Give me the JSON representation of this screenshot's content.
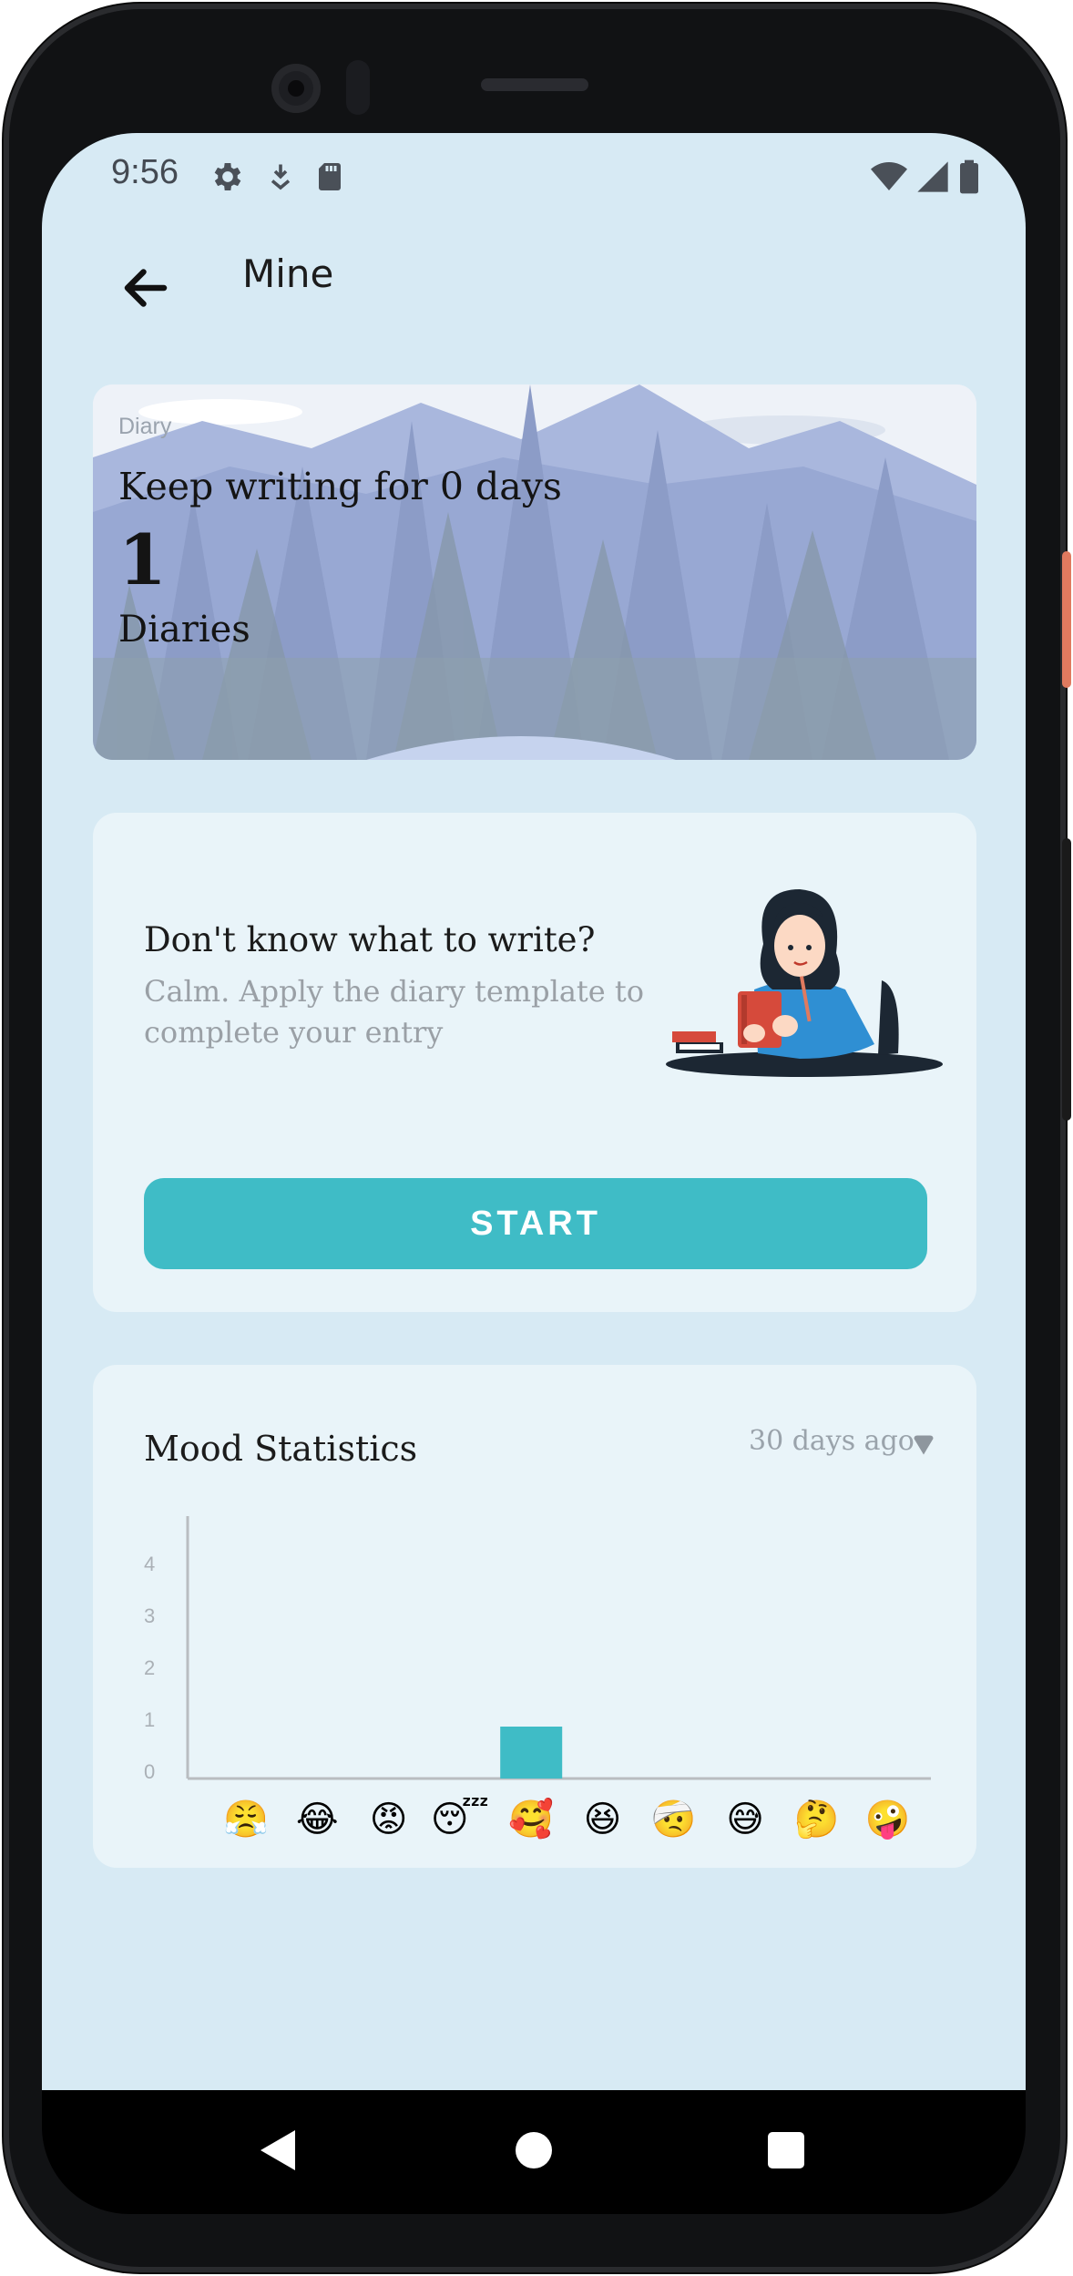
{
  "status_bar": {
    "time": "9:56",
    "left_icons": [
      "settings-icon",
      "download-icon",
      "sd-card-icon"
    ],
    "right_icons": [
      "wifi-icon",
      "signal-icon",
      "battery-icon"
    ]
  },
  "header": {
    "title": "Mine",
    "back_icon": "arrow-left-icon"
  },
  "diary_card": {
    "label": "Diary",
    "streak_text": "Keep writing for 0 days",
    "count": "1",
    "count_label": "Diaries"
  },
  "template_card": {
    "title": "Don't know what to write?",
    "subtitle": "Calm. Apply the diary template to complete your entry",
    "button_label": "START"
  },
  "mood_card": {
    "title": "Mood Statistics",
    "range_label": "30 days ago",
    "range_icon": "dropdown-caret-icon"
  },
  "chart_data": {
    "type": "bar",
    "categories": [
      "😤",
      "😂",
      "😡",
      "😴",
      "🥰",
      "😆",
      "🤕",
      "😅",
      "🤔",
      "🤪"
    ],
    "values": [
      0,
      0,
      0,
      0,
      1,
      0,
      0,
      0,
      0,
      0
    ],
    "yticks": [
      "0",
      "1",
      "2",
      "3",
      "4"
    ],
    "ylim": [
      0,
      4
    ],
    "bar_color": "#3fbcc6",
    "grid": false
  },
  "colors": {
    "screen_bg": "#d7eaf4",
    "card_bg": "#e9f4f9",
    "accent": "#3fbcc6"
  }
}
